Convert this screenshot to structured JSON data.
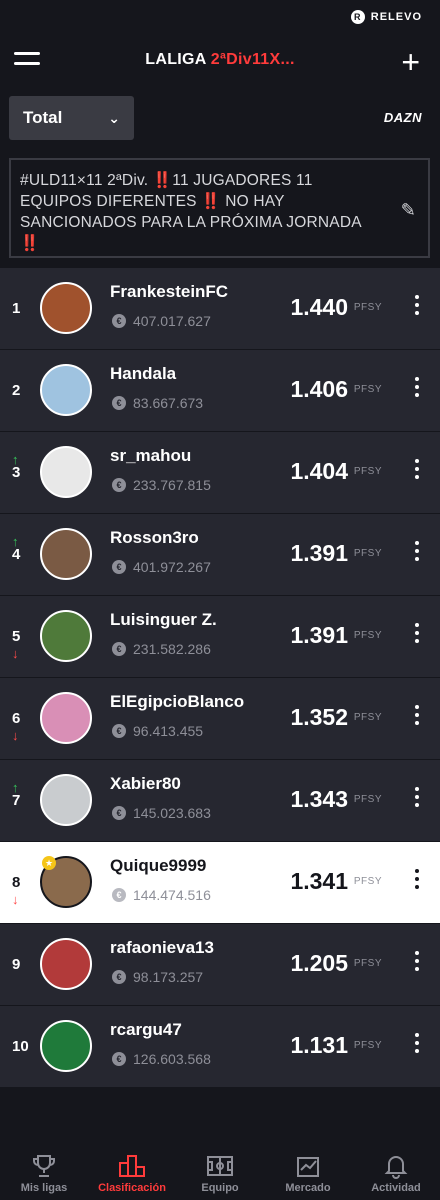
{
  "status": {
    "brand": "RELEVO"
  },
  "header": {
    "title_main": "LALIGA ",
    "title_accent": "2ªDiv11X..."
  },
  "filter": {
    "selected": "Total",
    "partner": "DAZN"
  },
  "notice": {
    "text": "#ULD11×11 2ªDiv. ‼️11 JUGADORES 11 EQUIPOS DIFERENTES ‼️ NO HAY SANCIONADOS PARA LA PRÓXIMA JORNADA ‼️"
  },
  "points_unit": "PFSY",
  "ranking": [
    {
      "rank": "1",
      "name": "FrankesteinFC",
      "value": "407.017.627",
      "points": "1.440",
      "trend": "none",
      "avatar_color": "#a0522d"
    },
    {
      "rank": "2",
      "name": "Handala",
      "value": "83.667.673",
      "points": "1.406",
      "trend": "none",
      "avatar_color": "#9fc3e0"
    },
    {
      "rank": "3",
      "name": "sr_mahou",
      "value": "233.767.815",
      "points": "1.404",
      "trend": "up",
      "avatar_color": "#e8e8e8"
    },
    {
      "rank": "4",
      "name": "Rosson3ro",
      "value": "401.972.267",
      "points": "1.391",
      "trend": "up",
      "avatar_color": "#7a5a44"
    },
    {
      "rank": "5",
      "name": "Luisinguer Z.",
      "value": "231.582.286",
      "points": "1.391",
      "trend": "down",
      "avatar_color": "#4f7a3a"
    },
    {
      "rank": "6",
      "name": "ElEgipcioBlanco",
      "value": "96.413.455",
      "points": "1.352",
      "trend": "down",
      "avatar_color": "#d98fb6"
    },
    {
      "rank": "7",
      "name": "Xabier80",
      "value": "145.023.683",
      "points": "1.343",
      "trend": "up",
      "avatar_color": "#c9cccf"
    },
    {
      "rank": "8",
      "name": "Quique9999",
      "value": "144.474.516",
      "points": "1.341",
      "trend": "down",
      "avatar_color": "#8a6a4c",
      "highlight": true
    },
    {
      "rank": "9",
      "name": "rafaonieva13",
      "value": "98.173.257",
      "points": "1.205",
      "trend": "none",
      "avatar_color": "#b23a3a"
    },
    {
      "rank": "10",
      "name": "rcargu47",
      "value": "126.603.568",
      "points": "1.131",
      "trend": "none",
      "avatar_color": "#1f7a3a"
    }
  ],
  "tabs": [
    {
      "label": "Mis ligas",
      "icon": "trophy-icon",
      "active": false
    },
    {
      "label": "Clasificación",
      "icon": "podium-icon",
      "active": true
    },
    {
      "label": "Equipo",
      "icon": "pitch-icon",
      "active": false
    },
    {
      "label": "Mercado",
      "icon": "market-icon",
      "active": false
    },
    {
      "label": "Actividad",
      "icon": "bell-icon",
      "active": false
    }
  ],
  "colors": {
    "background": "#15161c",
    "row": "#262730",
    "accent": "#ff3b3b",
    "up": "#36c25a",
    "down": "#ff4a4a"
  }
}
